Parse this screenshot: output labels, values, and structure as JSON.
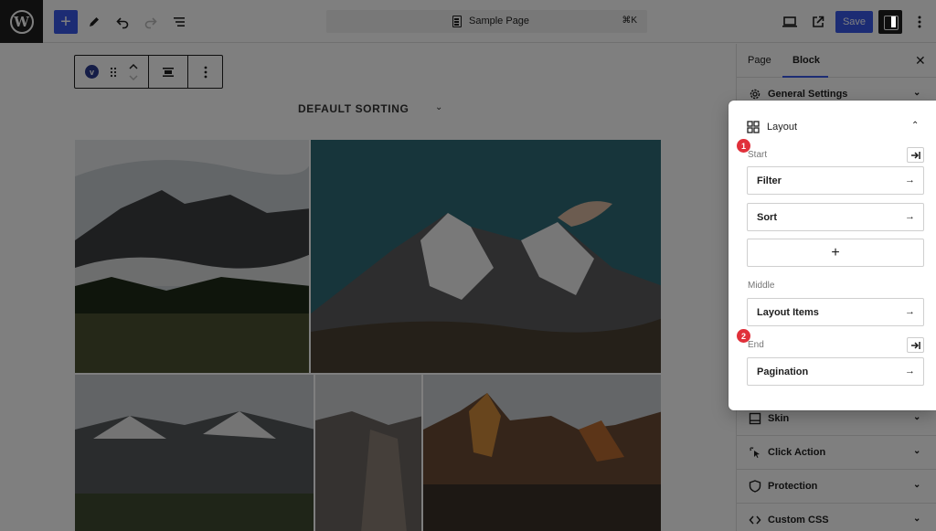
{
  "app": {
    "logo_letter": "W",
    "document_title": "Sample Page",
    "command_shortcut": "⌘K",
    "save_label": "Save"
  },
  "block_toolbar": {
    "block_badge": "v"
  },
  "canvas": {
    "sorting_label": "DEFAULT SORTING"
  },
  "sidebar": {
    "tabs": [
      {
        "label": "Page",
        "active": false
      },
      {
        "label": "Block",
        "active": true
      }
    ],
    "close_glyph": "✕",
    "panels": {
      "general_settings": "General Settings",
      "skin": "Skin",
      "click_action": "Click Action",
      "protection": "Protection",
      "custom_css": "Custom CSS"
    }
  },
  "layout_panel": {
    "title": "Layout",
    "sections": {
      "start": "Start",
      "middle": "Middle",
      "end": "End"
    },
    "items": {
      "filter": "Filter",
      "sort": "Sort",
      "layout_items": "Layout Items",
      "pagination": "Pagination"
    },
    "add_glyph": "+",
    "arrow_glyph": "→",
    "markers": [
      "1",
      "2"
    ]
  },
  "colors": {
    "accent": "#3858e9",
    "marker": "#e0303a",
    "dark": "#1e1e1e"
  }
}
